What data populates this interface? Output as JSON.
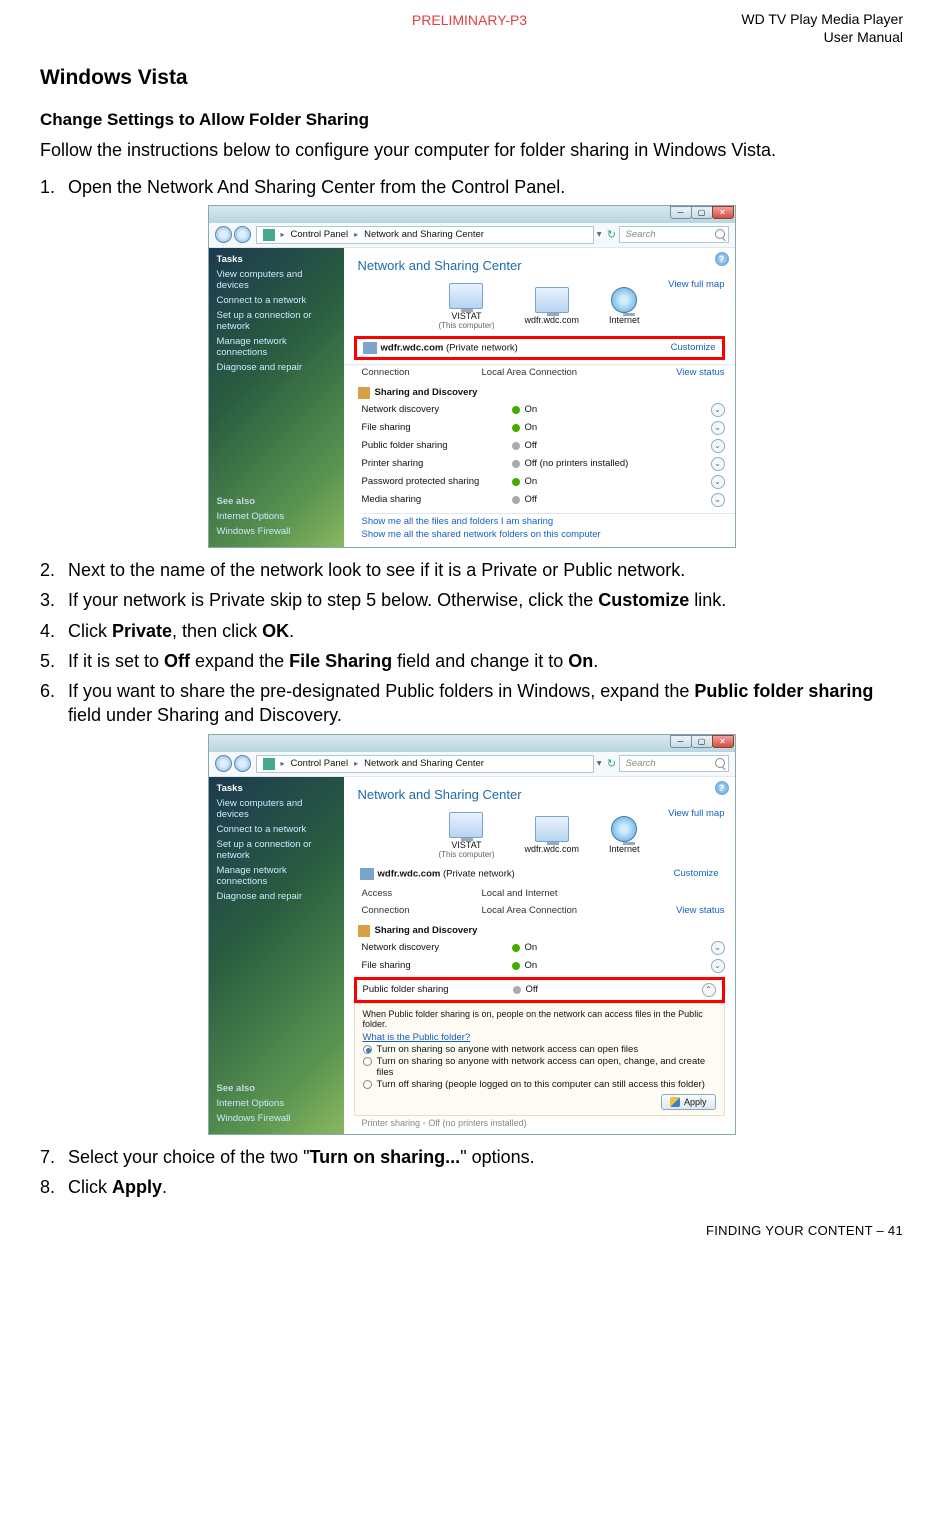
{
  "header": {
    "preliminary": "PRELIMINARY-P3",
    "doc_title_1": "WD TV Play Media Player",
    "doc_title_2": "User Manual"
  },
  "section": "Windows Vista",
  "subsection": "Change Settings to Allow Folder Sharing",
  "intro": "Follow the instructions below to configure your computer for folder sharing in Windows Vista.",
  "steps": {
    "s1": "Open the Network And Sharing Center from the Control Panel.",
    "s2": "Next to the name of the network look to see if it is a Private or Public network.",
    "s3a": "If your network is Private skip to step 5 below. Otherwise, click the ",
    "s3b": "Customize",
    "s3c": " link.",
    "s4a": "Click ",
    "s4b": "Private",
    "s4c": ", then click ",
    "s4d": "OK",
    "s4e": ".",
    "s5a": "If it is set to ",
    "s5b": "Off",
    "s5c": " expand the ",
    "s5d": "File Sharing",
    "s5e": " field and change it to ",
    "s5f": "On",
    "s5g": ".",
    "s6a": "If you want to share the pre-designated Public folders in Windows, expand the ",
    "s6b": "Public folder sharing",
    "s6c": " field under Sharing and Discovery.",
    "s7a": "Select your choice of the two \"",
    "s7b": "Turn on sharing...",
    "s7c": "\" options.",
    "s8a": "Click ",
    "s8b": "Apply",
    "s8c": "."
  },
  "vista": {
    "breadcrumb1": "Control Panel",
    "breadcrumb2": "Network and Sharing Center",
    "search_placeholder": "Search",
    "tasks_header": "Tasks",
    "task1": "View computers and devices",
    "task2": "Connect to a network",
    "task3": "Set up a connection or network",
    "task4": "Manage network connections",
    "task5": "Diagnose and repair",
    "see_also": "See also",
    "see1": "Internet Options",
    "see2": "Windows Firewall",
    "main_heading": "Network and Sharing Center",
    "view_full_map": "View full map",
    "node1": "VISTAT",
    "node1_sub": "(This computer)",
    "node2": "wdfr.wdc.com",
    "node3": "Internet",
    "network_name": "wdfr.wdc.com",
    "network_type": "(Private network)",
    "customize": "Customize",
    "access_k": "Access",
    "access_v": "Local and Internet",
    "conn_k": "Connection",
    "conn_v": "Local Area Connection",
    "view_status": "View status",
    "sd_header": "Sharing and Discovery",
    "sd": [
      {
        "k": "Network discovery",
        "v": "On",
        "on": true
      },
      {
        "k": "File sharing",
        "v": "On",
        "on": true
      },
      {
        "k": "Public folder sharing",
        "v": "Off",
        "on": false
      },
      {
        "k": "Printer sharing",
        "v": "Off (no printers installed)",
        "on": false
      },
      {
        "k": "Password protected sharing",
        "v": "On",
        "on": true
      },
      {
        "k": "Media sharing",
        "v": "Off",
        "on": false
      }
    ],
    "link1": "Show me all the files and folders I am sharing",
    "link2": "Show me all the shared network folders on this computer",
    "pfs_info": "When Public folder sharing is on, people on the network can access files in the Public folder.",
    "pfs_what": "What is the Public folder?",
    "pfs_r1": "Turn on sharing so anyone with network access can open files",
    "pfs_r2": "Turn on sharing so anyone with network access can open, change, and create files",
    "pfs_r3": "Turn off sharing (people logged on to this computer can still access this folder)",
    "apply": "Apply",
    "cutoff": "Printer sharing           ◦ Off (no printers installed)"
  },
  "footer": "FINDING YOUR CONTENT – 41"
}
